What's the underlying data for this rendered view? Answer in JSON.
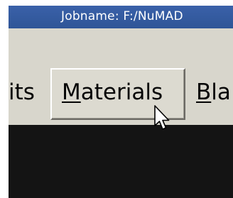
{
  "titlebar": {
    "title": "Jobname: F:/NuMAD"
  },
  "menu": {
    "items": [
      {
        "label": "its",
        "state": "default"
      },
      {
        "label": "Materials",
        "state": "pressed",
        "mnemonic": "M"
      },
      {
        "label": "Bla",
        "state": "default",
        "mnemonic": "B"
      }
    ]
  },
  "cursor": {
    "icon": "mouse-pointer-icon"
  },
  "colors": {
    "titlebar": "#2f5597",
    "menubar": "#d8d6cc",
    "content": "#141414"
  }
}
